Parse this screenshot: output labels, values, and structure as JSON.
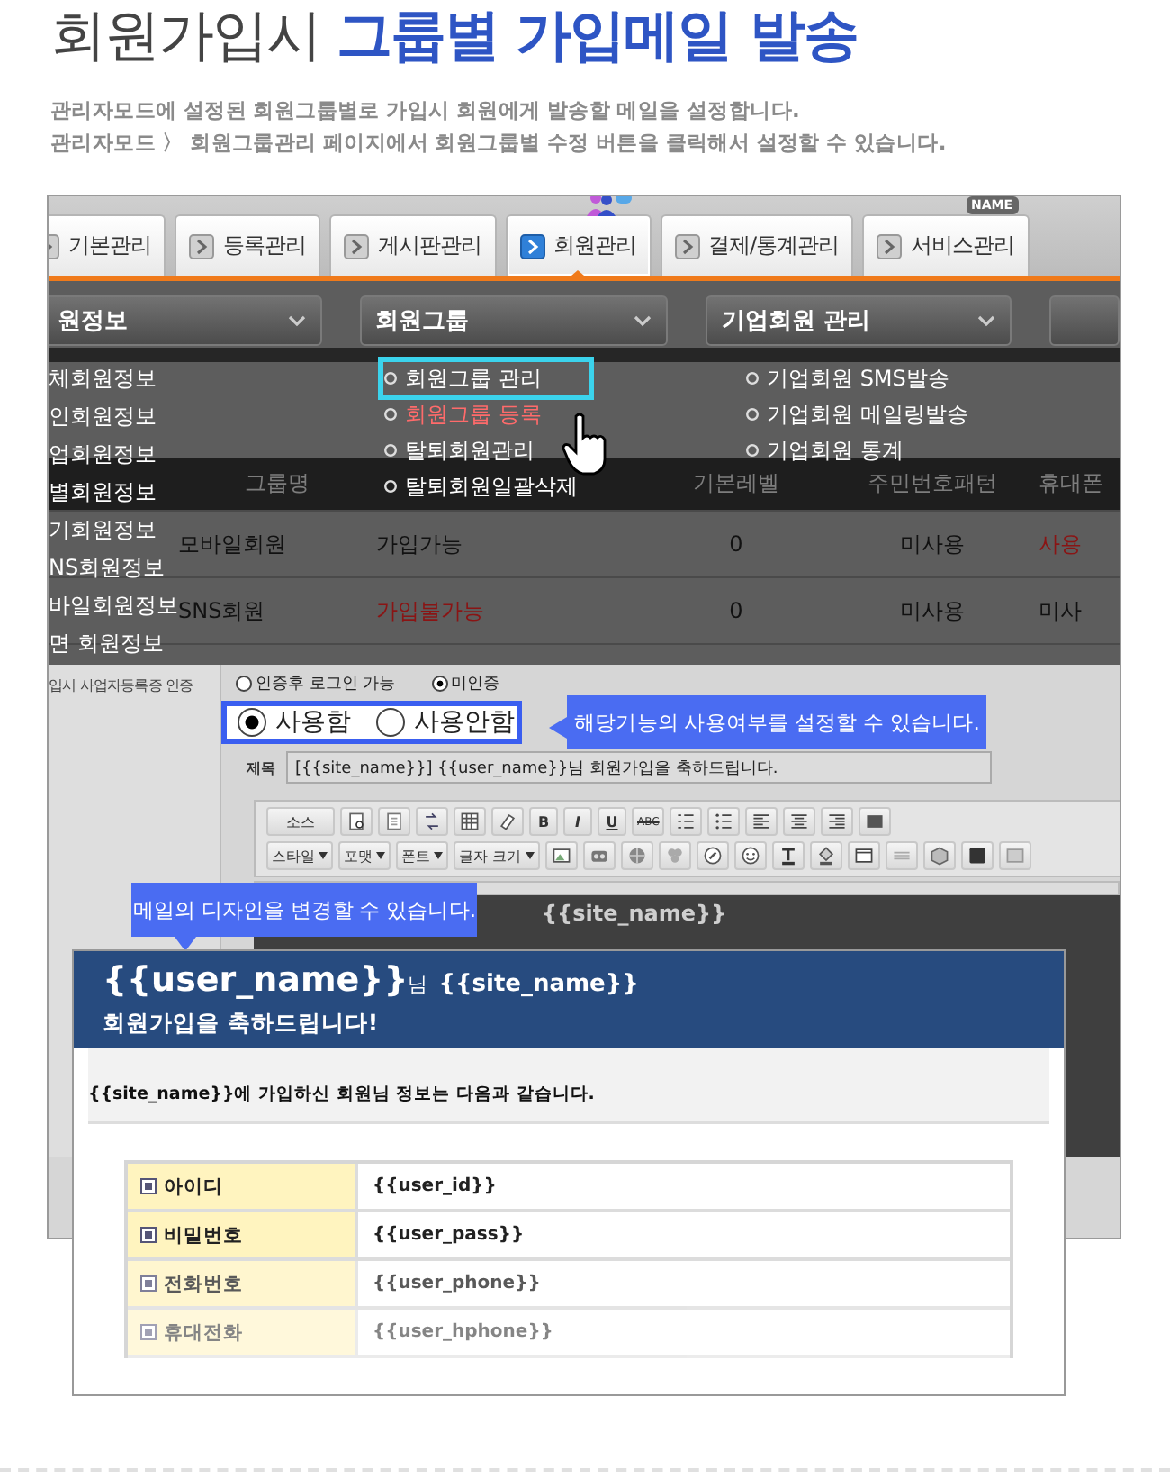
{
  "title": {
    "plain": "회원가입시",
    "highlight": "그룹별 가입메일 발송"
  },
  "description": [
    "관리자모드에 설정된 회원그룹별로 가입시 회원에게 발송할 메일을 설정합니다.",
    "관리자모드 〉 회원그룹관리 페이지에서 회원그룹별 수정 버튼을 클릭해서 설정할 수 있습니다."
  ],
  "tabs": [
    {
      "label": "기본관리",
      "selected": false
    },
    {
      "label": "등록관리",
      "selected": false
    },
    {
      "label": "게시판관리",
      "selected": false
    },
    {
      "label": "회원관리",
      "selected": true
    },
    {
      "label": "결제/통계관리",
      "selected": false
    },
    {
      "label": "서비스관리",
      "selected": false,
      "badge": "NAME"
    }
  ],
  "menus": [
    {
      "title": "원정보",
      "items": [
        {
          "label": "체회원정보",
          "selected": false,
          "hovered": false
        },
        {
          "label": "인회원정보",
          "selected": false,
          "hovered": false
        },
        {
          "label": "업회원정보",
          "selected": false,
          "hovered": false
        },
        {
          "label": "별회원정보",
          "selected": false,
          "hovered": false
        },
        {
          "label": "기회원정보",
          "selected": false,
          "hovered": false
        },
        {
          "label": "NS회원정보",
          "selected": false,
          "hovered": false
        },
        {
          "label": "바일회원정보",
          "selected": false,
          "hovered": false
        },
        {
          "label": "면 회원정보",
          "selected": false,
          "hovered": false
        }
      ]
    },
    {
      "title": "회원그룹",
      "items": [
        {
          "label": "회원그룹 관리",
          "selected": true,
          "hovered": false
        },
        {
          "label": "회원그룹 등록",
          "selected": false,
          "hovered": true
        },
        {
          "label": "탈퇴회원관리",
          "selected": false,
          "hovered": false
        },
        {
          "label": "탈퇴회원일괄삭제",
          "selected": false,
          "hovered": false
        }
      ]
    },
    {
      "title": "기업회원 관리",
      "items": [
        {
          "label": "기업회원 SMS발송",
          "selected": false,
          "hovered": false
        },
        {
          "label": "기업회원 메일링발송",
          "selected": false,
          "hovered": false
        },
        {
          "label": "기업회원 통계",
          "selected": false,
          "hovered": false
        }
      ]
    }
  ],
  "group_table": {
    "header": {
      "name": "그룹명",
      "level": "기본레벨",
      "pattern": "주민번호패턴",
      "mobile": "휴대폰"
    },
    "rows": [
      {
        "name": "모바일회원",
        "join": "가입가능",
        "join_allowed": true,
        "level": "0",
        "pattern": "미사용",
        "mobile": "사용",
        "mobile_used": true
      },
      {
        "name": "SNS회원",
        "join": "가입불가능",
        "join_allowed": false,
        "level": "0",
        "pattern": "미사용",
        "mobile": "미사",
        "mobile_used": false
      }
    ]
  },
  "business_cert": {
    "label": "입시 사업자등록증 인증",
    "options": [
      {
        "label": "인증후 로그인 가능",
        "selected": false
      },
      {
        "label": "미인증",
        "selected": true
      }
    ]
  },
  "usage": {
    "options": [
      {
        "label": "사용함",
        "selected": true
      },
      {
        "label": "사용안함",
        "selected": false
      }
    ],
    "tooltip": "해당기능의 사용여부를 설정할 수 있습니다."
  },
  "subject": {
    "label": "제목",
    "value": "[{{site_name}}] {{user_name}}님 회원가입을 축하드립니다."
  },
  "toolbar": {
    "source": "소스",
    "format_buttons": [
      "B",
      "I",
      "U",
      "ABC"
    ],
    "dropdowns": [
      "스타일",
      "포맷",
      "폰트",
      "글자 크기"
    ]
  },
  "editor_text": "{{site_name}}",
  "design_tooltip": "메일의 디자인을 변경할 수 있습니다.",
  "email": {
    "user_name": "{{user_name}}",
    "honorific": "님",
    "site_name": "{{site_name}}",
    "greeting": "회원가입을 축하드립니다!",
    "intro": "{{site_name}}에 가입하신 회원님 정보는 다음과 같습니다.",
    "fields": [
      {
        "label": "아이디",
        "value": "{{user_id}}"
      },
      {
        "label": "비밀번호",
        "value": "{{user_pass}}"
      },
      {
        "label": "전화번호",
        "value": "{{user_phone}}"
      },
      {
        "label": "휴대전화",
        "value": "{{user_hphone}}"
      }
    ]
  }
}
